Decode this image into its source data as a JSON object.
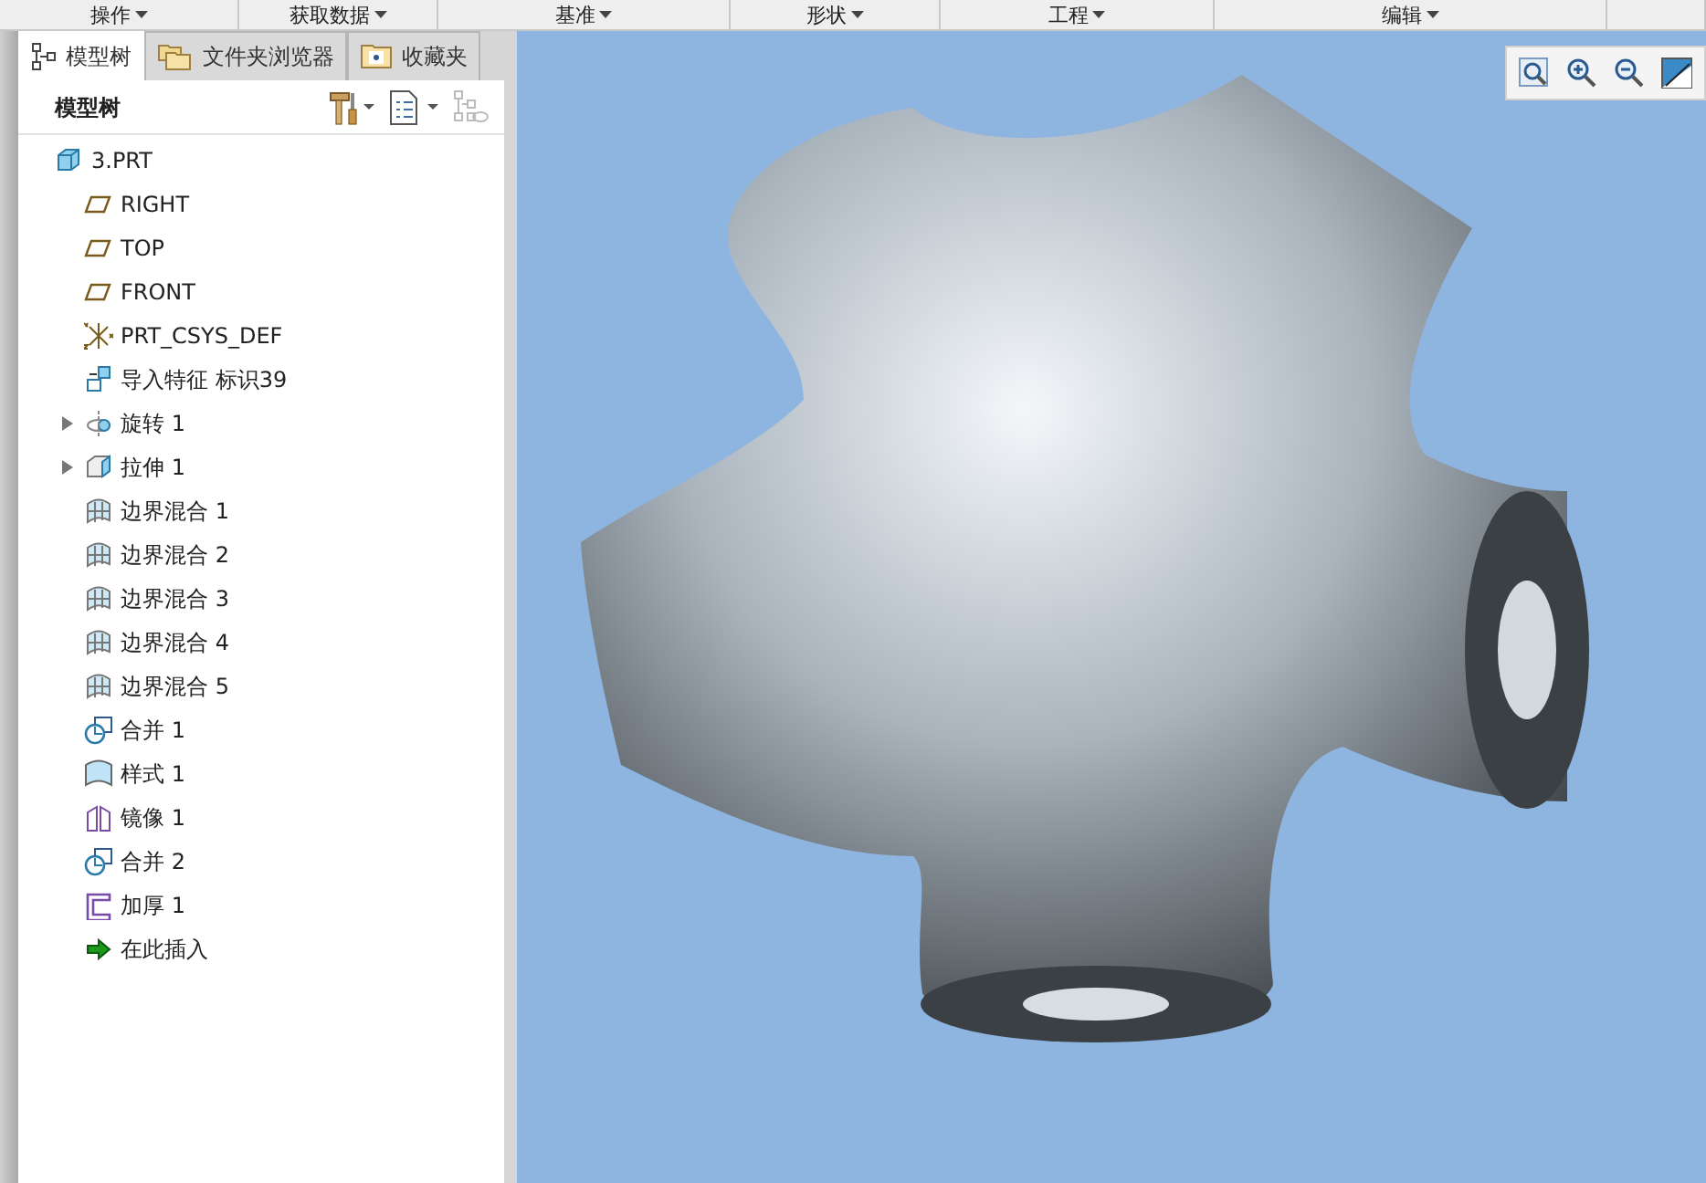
{
  "menu_bar": [
    {
      "label": "操作"
    },
    {
      "label": "获取数据"
    },
    {
      "label": "基准"
    },
    {
      "label": "形状"
    },
    {
      "label": "工程"
    },
    {
      "label": "编辑"
    }
  ],
  "tabs": [
    {
      "label": "模型树",
      "kind": "tree",
      "selected": true
    },
    {
      "label": "文件夹浏览器",
      "kind": "folders",
      "selected": false
    },
    {
      "label": "收藏夹",
      "kind": "favorites",
      "selected": false
    }
  ],
  "tree_header": {
    "title": "模型树"
  },
  "tree": [
    {
      "label": "3.PRT",
      "kind": "part",
      "children": [
        {
          "label": "RIGHT",
          "kind": "plane"
        },
        {
          "label": "TOP",
          "kind": "plane"
        },
        {
          "label": "FRONT",
          "kind": "plane"
        },
        {
          "label": "PRT_CSYS_DEF",
          "kind": "csys"
        },
        {
          "label": "导入特征 标识39",
          "kind": "import"
        },
        {
          "label": "旋转 1",
          "kind": "revolve",
          "expanded": false
        },
        {
          "label": "拉伸 1",
          "kind": "extrude",
          "expanded": false
        },
        {
          "label": "边界混合 1",
          "kind": "blend"
        },
        {
          "label": "边界混合 2",
          "kind": "blend"
        },
        {
          "label": "边界混合 3",
          "kind": "blend"
        },
        {
          "label": "边界混合 4",
          "kind": "blend"
        },
        {
          "label": "边界混合 5",
          "kind": "blend"
        },
        {
          "label": "合并 1",
          "kind": "merge"
        },
        {
          "label": "样式 1",
          "kind": "style"
        },
        {
          "label": "镜像 1",
          "kind": "mirror"
        },
        {
          "label": "合并 2",
          "kind": "merge"
        },
        {
          "label": "加厚 1",
          "kind": "thicken"
        },
        {
          "label": "在此插入",
          "kind": "insert"
        }
      ]
    }
  ]
}
